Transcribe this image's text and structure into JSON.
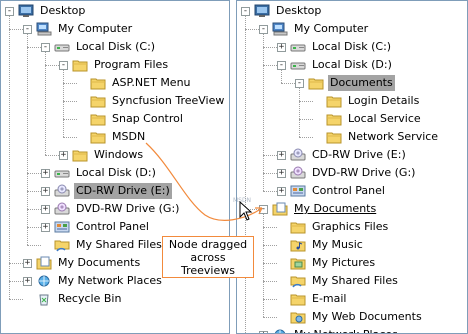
{
  "left_tree": {
    "nodes": [
      {
        "label": "Desktop",
        "icon": "desktop-icon"
      },
      {
        "label": "My Computer",
        "icon": "computer-icon"
      },
      {
        "label": "Local Disk (C:)",
        "icon": "drive-icon"
      },
      {
        "label": "Program Files",
        "icon": "folder-icon"
      },
      {
        "label": "ASP.NET Menu",
        "icon": "folder-icon"
      },
      {
        "label": "Syncfusion TreeView",
        "icon": "folder-icon"
      },
      {
        "label": "Snap Control",
        "icon": "folder-icon"
      },
      {
        "label": "MSDN",
        "icon": "folder-icon"
      },
      {
        "label": "Windows",
        "icon": "folder-icon"
      },
      {
        "label": "Local Disk (D:)",
        "icon": "drive-icon"
      },
      {
        "label": "CD-RW Drive (E:)",
        "icon": "cd-drive-icon"
      },
      {
        "label": "DVD-RW Drive (G:)",
        "icon": "dvd-drive-icon"
      },
      {
        "label": "Control Panel",
        "icon": "control-panel-icon"
      },
      {
        "label": "My Shared Files",
        "icon": "shared-folder-icon"
      },
      {
        "label": "My Documents",
        "icon": "documents-icon"
      },
      {
        "label": "My Network Places",
        "icon": "network-icon"
      },
      {
        "label": "Recycle Bin",
        "icon": "recycle-bin-icon"
      }
    ]
  },
  "right_tree": {
    "nodes": [
      {
        "label": "Desktop",
        "icon": "desktop-icon"
      },
      {
        "label": "My Computer",
        "icon": "computer-icon"
      },
      {
        "label": "Local Disk (C:)",
        "icon": "drive-icon"
      },
      {
        "label": "Local Disk (D:)",
        "icon": "drive-icon"
      },
      {
        "label": "Documents",
        "icon": "folder-icon"
      },
      {
        "label": "Login Details",
        "icon": "folder-icon"
      },
      {
        "label": "Local Service",
        "icon": "folder-icon"
      },
      {
        "label": "Network Service",
        "icon": "folder-icon"
      },
      {
        "label": "CD-RW Drive (E:)",
        "icon": "cd-drive-icon"
      },
      {
        "label": "DVD-RW Drive (G:)",
        "icon": "dvd-drive-icon"
      },
      {
        "label": "Control Panel",
        "icon": "control-panel-icon"
      },
      {
        "label": "My Documents",
        "icon": "documents-icon"
      },
      {
        "label": "Graphics Files",
        "icon": "folder-icon"
      },
      {
        "label": "My Music",
        "icon": "music-folder-icon"
      },
      {
        "label": "My Pictures",
        "icon": "pictures-folder-icon"
      },
      {
        "label": "My Shared Files",
        "icon": "shared-folder-icon"
      },
      {
        "label": "E-mail",
        "icon": "folder-icon"
      },
      {
        "label": "My Web Documents",
        "icon": "web-folder-icon"
      },
      {
        "label": "My Network Places",
        "icon": "network-icon"
      }
    ]
  },
  "callout": {
    "line1": "Node dragged",
    "line2": "across",
    "line3": "Treeviews"
  },
  "drag_ghost": "MSDN",
  "colors": {
    "tree_border": "#7f9db9",
    "selection": "#a3a3a3",
    "callout_border": "#f28a3c",
    "connector": "#f28a3c",
    "folder": "#f5d46a"
  }
}
